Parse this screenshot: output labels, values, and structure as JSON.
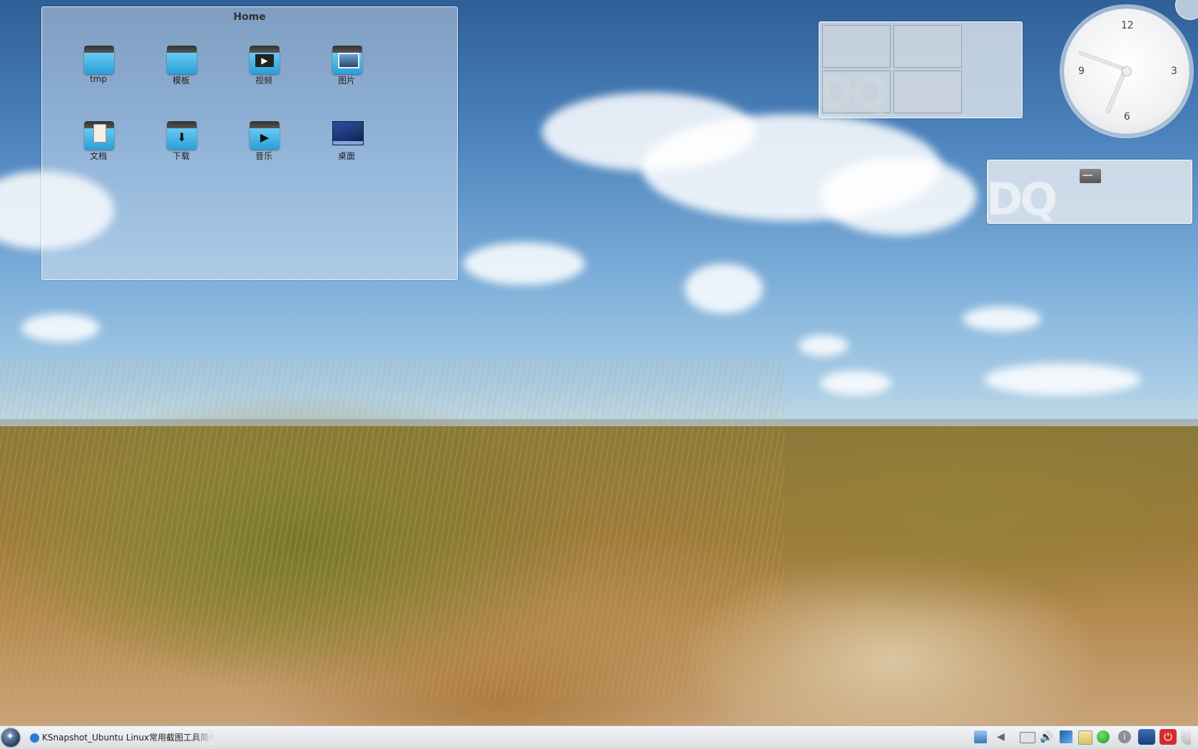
{
  "folder_view": {
    "title": "Home",
    "items": [
      {
        "label": "tmp",
        "icon": "folder-icon"
      },
      {
        "label": "模板",
        "icon": "folder-templates-icon"
      },
      {
        "label": "视频",
        "icon": "folder-videos-icon"
      },
      {
        "label": "图片",
        "icon": "folder-pictures-icon"
      },
      {
        "label": "文档",
        "icon": "folder-documents-icon"
      },
      {
        "label": "下载",
        "icon": "folder-downloads-icon"
      },
      {
        "label": "音乐",
        "icon": "folder-music-icon"
      },
      {
        "label": "桌面",
        "icon": "desktop-icon"
      }
    ]
  },
  "clock": {
    "numerals": [
      "12",
      "3",
      "6",
      "9"
    ],
    "time_shown": "5:52"
  },
  "panel": {
    "task_label": "KSnapshot_Ubuntu Linux常用截图工具简单介",
    "tray_icons": [
      "clipboard-icon",
      "arrow-left-icon",
      "keyboard-icon",
      "volume-icon",
      "network-icon",
      "notes-icon",
      "green-status-icon",
      "info-icon",
      "lock-icon",
      "power-icon"
    ]
  },
  "colors": {
    "folder_blue": "#2a9fd8",
    "panel_bg": "#e2e5e8",
    "power_red": "#d62b2b"
  }
}
